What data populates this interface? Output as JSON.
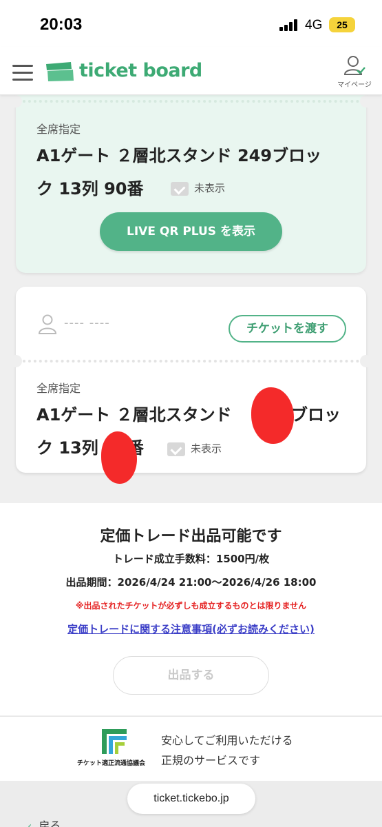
{
  "status_bar": {
    "time": "20:03",
    "network": "4G",
    "battery": "25"
  },
  "header": {
    "logo_text": "ticket board",
    "mypage_label": "マイページ"
  },
  "tickets": [
    {
      "seat_type": "全席指定",
      "seat_line1": "A1ゲート ２層北スタンド 249ブロッ",
      "seat_line2": "ク 13列 90番",
      "hidden_label": "未表示",
      "qr_button": "LIVE QR PLUS を表示"
    },
    {
      "user_name": "---- ----",
      "transfer_button": "チケットを渡す",
      "seat_type": "全席指定",
      "seat_line1": "A1ゲート ２層北スタンド",
      "seat_line1_tail": "ブロッ",
      "seat_line2_a": "ク 13列",
      "seat_line2_b": "番",
      "hidden_label": "未表示"
    }
  ],
  "trade": {
    "title": "定価トレード出品可能です",
    "fee": "トレード成立手数料：1500円/枚",
    "period": "出品期間：2026/4/24 21:00〜2026/4/26 18:00",
    "warning": "※出品されたチケットが必ずしも成立するものとは限りません",
    "notes_link": "定価トレードに関する注意事項(必ずお読みください)",
    "list_button": "出品する"
  },
  "certification": {
    "org_name": "チケット適正流通協議会",
    "text_line1": "安心してご利用いただける",
    "text_line2": "正規のサービスです"
  },
  "browser": {
    "url": "ticket.tickebo.jp",
    "back_label": "戻る"
  },
  "colors": {
    "brand_green": "#52b388",
    "warning_red": "#e52222",
    "link_blue": "#3b3ec7"
  }
}
